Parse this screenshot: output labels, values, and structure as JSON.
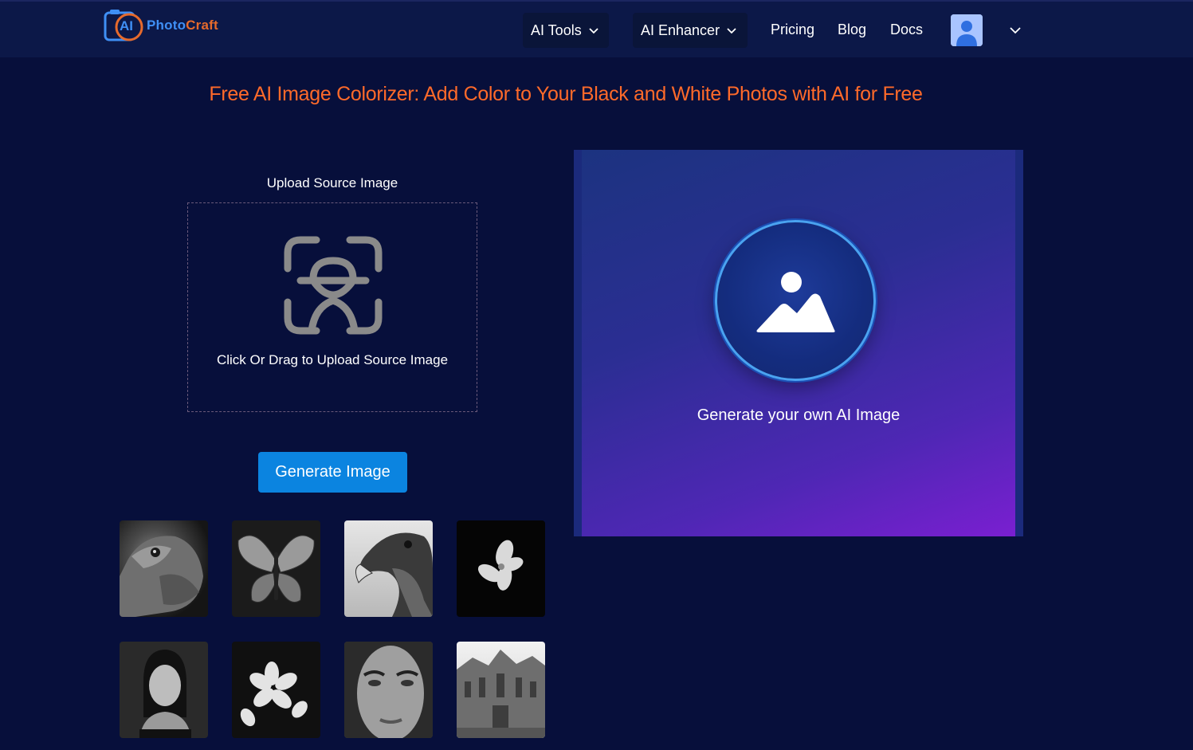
{
  "nav": {
    "logo_ai": "AI",
    "logo_photo": "Photo",
    "logo_craft": "Craft",
    "dropdowns": [
      {
        "label": "AI Tools"
      },
      {
        "label": "AI Enhancer"
      }
    ],
    "links": [
      {
        "label": "Pricing"
      },
      {
        "label": "Blog"
      },
      {
        "label": "Docs"
      }
    ]
  },
  "page": {
    "title": "Free AI Image Colorizer: Add Color to Your Black and White Photos with AI for Free"
  },
  "upload": {
    "label": "Upload Source Image",
    "hint": "Click Or Drag to Upload Source Image"
  },
  "actions": {
    "generate_label": "Generate Image"
  },
  "preview": {
    "text": "Generate your own AI Image"
  },
  "samples": [
    {
      "name": "sample-iguana"
    },
    {
      "name": "sample-butterfly"
    },
    {
      "name": "sample-eagle"
    },
    {
      "name": "sample-flower"
    },
    {
      "name": "sample-woman-portrait"
    },
    {
      "name": "sample-plumeria"
    },
    {
      "name": "sample-face-closeup"
    },
    {
      "name": "sample-cathedral"
    }
  ],
  "colors": {
    "background": "#070f3b",
    "navbar": "#0c1848",
    "title": "#ff6a2a",
    "button": "#0b84e0",
    "preview_start": "#1c3380",
    "preview_end": "#7a1fd1"
  }
}
